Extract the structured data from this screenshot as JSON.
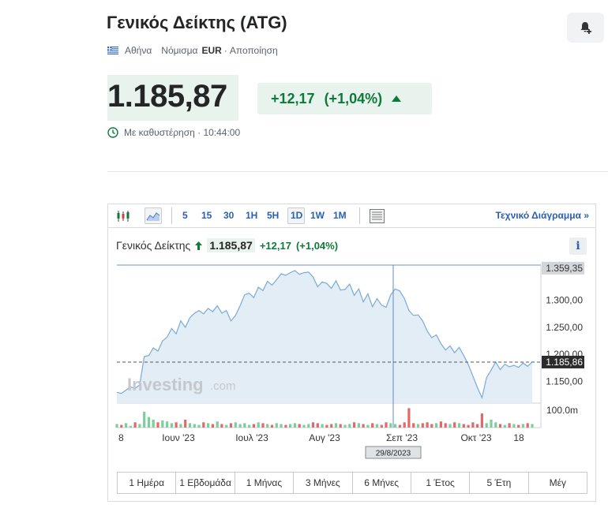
{
  "header": {
    "title": "Γενικός Δείκτης (ATG)",
    "exchange": "Αθήνα",
    "currency_label": "Νόμισμα",
    "currency": "EUR",
    "disclaimer": "Αποποίηση"
  },
  "quote": {
    "price": "1.185,87",
    "change": "+12,17",
    "change_pct": "(+1,04%)",
    "delay_label": "Με καθυστέρηση · 10:44:00"
  },
  "toolbar": {
    "intervals": [
      "5",
      "15",
      "30",
      "1H",
      "5H",
      "1D",
      "1W",
      "1M"
    ],
    "selected_interval": "1D",
    "technical_chart_label": "Τεχνικό Διάγραμμα »"
  },
  "legend": {
    "name": "Γενικός Δείκτης",
    "value": "1.185,87",
    "change": "+12,17",
    "change_pct": "(+1,04%)"
  },
  "chart_data": {
    "type": "area",
    "x_tick_labels": [
      "8",
      "Ιουν '23",
      "Ιουλ '23",
      "Αυγ '23",
      "Σεπ '23",
      "Οκτ '23",
      "18"
    ],
    "y_tick_labels": [
      "1.359,35",
      "1.300,00",
      "1.250,00",
      "1.200,00",
      "1.185,86",
      "1.150,00"
    ],
    "volume_label": "100.0m",
    "crosshair_date": "29/8/2023",
    "last_value": 1185.86,
    "high_value": 1359.35,
    "ylim": [
      1110,
      1365
    ],
    "watermark": "Investing",
    "watermark_suffix": ".com",
    "values": [
      1130,
      1128,
      1134,
      1140,
      1137,
      1144,
      1196,
      1198,
      1212,
      1206,
      1225,
      1232,
      1248,
      1238,
      1262,
      1250,
      1268,
      1276,
      1281,
      1275,
      1285,
      1279,
      1290,
      1276,
      1281,
      1262,
      1272,
      1290,
      1310,
      1313,
      1305,
      1324,
      1318,
      1335,
      1328,
      1338,
      1349,
      1346,
      1351,
      1355,
      1348,
      1351,
      1352,
      1343,
      1325,
      1334,
      1331,
      1322,
      1336,
      1319,
      1320,
      1330,
      1309,
      1321,
      1297,
      1312,
      1288,
      1303,
      1291,
      1287,
      1310,
      1321,
      1317,
      1303,
      1281,
      1272,
      1273,
      1262,
      1243,
      1231,
      1236,
      1220,
      1208,
      1216,
      1203,
      1213,
      1198,
      1181,
      1160,
      1139,
      1120,
      1157,
      1171,
      1186,
      1172,
      1182,
      1177,
      1180,
      1176,
      1184,
      1178,
      1186
    ],
    "volumes": [
      4,
      3,
      5,
      2,
      6,
      4,
      18,
      12,
      9,
      6,
      8,
      7,
      5,
      6,
      4,
      9,
      5,
      4,
      3,
      6,
      5,
      4,
      7,
      4,
      3,
      5,
      6,
      4,
      5,
      3,
      4,
      6,
      5,
      4,
      3,
      5,
      4,
      3,
      4,
      5,
      4,
      3,
      4,
      6,
      5,
      4,
      3,
      4,
      5,
      4,
      3,
      4,
      6,
      5,
      4,
      3,
      5,
      4,
      3,
      6,
      5,
      4,
      3,
      6,
      22,
      5,
      4,
      5,
      6,
      4,
      5,
      7,
      5,
      4,
      6,
      5,
      4,
      3,
      6,
      4,
      16,
      5,
      9,
      6,
      4,
      3,
      5,
      4,
      3,
      4,
      5,
      4
    ],
    "volume_colors": [
      "up",
      "down"
    ]
  },
  "ranges": [
    "1 Ημέρα",
    "1 Εβδομάδα",
    "1 Μήνας",
    "3 Μήνες",
    "6 Μήνες",
    "1 Έτος",
    "5 Έτη",
    "Μέγ"
  ],
  "colors": {
    "up": "#0e7a3a",
    "line": "#7aaad6",
    "area": "#e3edf6",
    "vol_up": "#7ccf9b",
    "vol_down": "#e06a6a",
    "link": "#2a5fb0"
  }
}
